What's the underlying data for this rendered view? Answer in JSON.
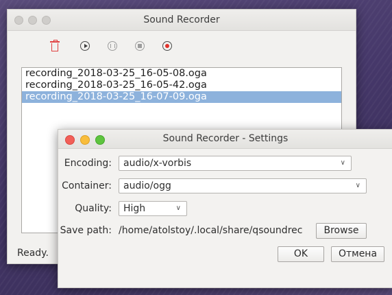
{
  "main_window": {
    "title": "Sound Recorder",
    "recordings": [
      "recording_2018-03-25_16-05-08.oga",
      "recording_2018-03-25_16-05-42.oga",
      "recording_2018-03-25_16-07-09.oga"
    ],
    "selected_index": 2,
    "status": "Ready."
  },
  "settings_dialog": {
    "title": "Sound Recorder - Settings",
    "encoding": {
      "label": "Encoding:",
      "value": "audio/x-vorbis"
    },
    "container": {
      "label": "Container:",
      "value": "audio/ogg"
    },
    "quality": {
      "label": "Quality:",
      "value": "High"
    },
    "save_path": {
      "label": "Save path:",
      "value": "/home/atolstoy/.local/share/qsoundrec"
    },
    "browse_label": "Browse",
    "ok_label": "OK",
    "cancel_label": "Отмена"
  },
  "icons": {
    "delete": "trash-icon",
    "play": "play-icon",
    "pause": "pause-icon",
    "stop": "stop-icon",
    "record": "record-icon"
  },
  "colors": {
    "accent_selection": "#8db2dc",
    "delete_red": "#e04040",
    "record_red": "#e0322b",
    "close_red": "#f25f58",
    "minimize_yellow": "#f9bd3b",
    "maximize_green": "#5ec43f"
  }
}
